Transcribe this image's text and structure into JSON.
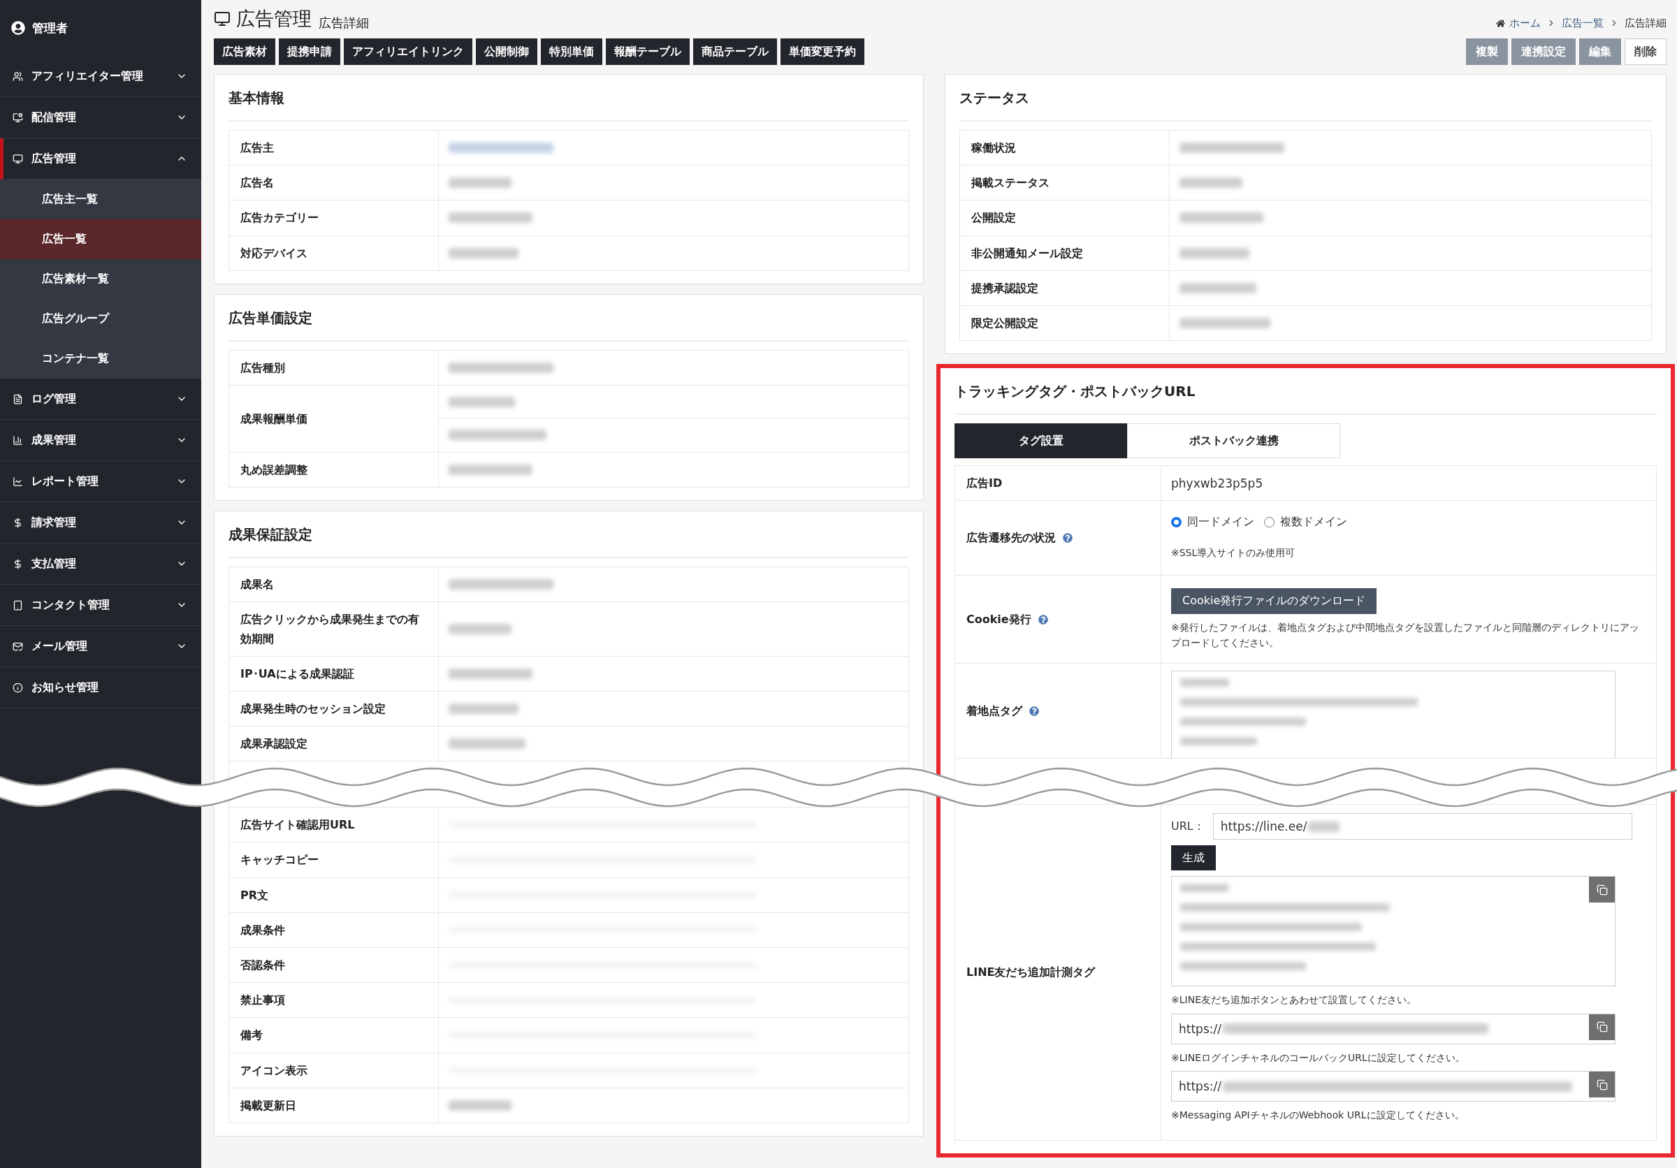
{
  "sidebar": {
    "user": "管理者",
    "items": [
      {
        "label": "アフィリエイター管理",
        "kind": "group",
        "active": false,
        "expanded": false
      },
      {
        "label": "配信管理",
        "kind": "group",
        "active": false,
        "expanded": false
      },
      {
        "label": "広告管理",
        "kind": "group",
        "active": true,
        "expanded": true,
        "children": [
          {
            "label": "広告主一覧",
            "selected": false
          },
          {
            "label": "広告一覧",
            "selected": true
          },
          {
            "label": "広告素材一覧",
            "selected": false
          },
          {
            "label": "広告グループ",
            "selected": false
          },
          {
            "label": "コンテナ一覧",
            "selected": false
          }
        ]
      },
      {
        "label": "ログ管理",
        "kind": "group",
        "active": false,
        "expanded": false
      },
      {
        "label": "成果管理",
        "kind": "group",
        "active": false,
        "expanded": false
      },
      {
        "label": "レポート管理",
        "kind": "group",
        "active": false,
        "expanded": false
      },
      {
        "label": "請求管理",
        "kind": "group",
        "active": false,
        "expanded": false
      },
      {
        "label": "支払管理",
        "kind": "group",
        "active": false,
        "expanded": false
      },
      {
        "label": "コンタクト管理",
        "kind": "group",
        "active": false,
        "expanded": false
      },
      {
        "label": "メール管理",
        "kind": "group",
        "active": false,
        "expanded": false
      },
      {
        "label": "お知らせ管理",
        "kind": "link",
        "active": false
      }
    ]
  },
  "header": {
    "title": "広告管理",
    "subtitle": "広告詳細",
    "breadcrumb": [
      "ホーム",
      "広告一覧",
      "広告詳細"
    ]
  },
  "nav_buttons": [
    "広告素材",
    "提携申請",
    "アフィリエイトリンク",
    "公開制御",
    "特別単価",
    "報酬テーブル",
    "商品テーブル",
    "単価変更予約"
  ],
  "actions": [
    {
      "label": "複製",
      "kind": "secondary"
    },
    {
      "label": "連携設定",
      "kind": "secondary"
    },
    {
      "label": "編集",
      "kind": "secondary"
    },
    {
      "label": "削除",
      "kind": "outline"
    }
  ],
  "left_panels": [
    {
      "title": "基本情報",
      "rows": [
        {
          "label": "広告主",
          "kind": "blurred"
        },
        {
          "label": "広告名",
          "kind": "blurred"
        },
        {
          "label": "広告カテゴリー",
          "kind": "blurred"
        },
        {
          "label": "対応デバイス",
          "kind": "blurred"
        }
      ]
    },
    {
      "title": "広告単価設定",
      "rows": [
        {
          "label": "広告種別",
          "kind": "blurred"
        },
        {
          "label": "成果報酬単価",
          "kind": "double"
        },
        {
          "label": "丸め誤差調整",
          "kind": "blurred"
        }
      ]
    },
    {
      "title": "成果保証設定",
      "rows": [
        {
          "label": "成果名",
          "kind": "blurred"
        },
        {
          "label": "広告クリックから成果発生までの有効期間",
          "kind": "blurred"
        },
        {
          "label": "IP･UAによる成果認証",
          "kind": "blurred"
        },
        {
          "label": "成果発生時のセッション設定",
          "kind": "blurred"
        },
        {
          "label": "成果承認設定",
          "kind": "blurred",
          "break_after": true
        },
        {
          "label": "広告サイト確認用URL",
          "kind": "empty"
        },
        {
          "label": "キャッチコピー",
          "kind": "empty"
        },
        {
          "label": "PR文",
          "kind": "empty"
        },
        {
          "label": "成果条件",
          "kind": "empty"
        },
        {
          "label": "否認条件",
          "kind": "empty"
        },
        {
          "label": "禁止事項",
          "kind": "empty"
        },
        {
          "label": "備考",
          "kind": "empty"
        },
        {
          "label": "アイコン表示",
          "kind": "empty"
        },
        {
          "label": "掲載更新日",
          "kind": "blurred"
        }
      ]
    }
  ],
  "status_panel": {
    "title": "ステータス",
    "rows": [
      {
        "label": "稼働状況",
        "kind": "blurred"
      },
      {
        "label": "掲載ステータス",
        "kind": "blurred"
      },
      {
        "label": "公開設定",
        "kind": "blurred"
      },
      {
        "label": "非公開通知メール設定",
        "kind": "blurred"
      },
      {
        "label": "提携承認設定",
        "kind": "blurred"
      },
      {
        "label": "限定公開設定",
        "kind": "blurred"
      }
    ]
  },
  "tracking_panel": {
    "title": "トラッキングタグ・ポストバックURL",
    "highlighted": true,
    "tabs": [
      {
        "label": "タグ設置",
        "selected": true
      },
      {
        "label": "ポストバック連携",
        "selected": false
      }
    ],
    "rows": [
      {
        "kind": "text",
        "label": "広告ID",
        "help": false,
        "value": "phyxwb23p5p5"
      },
      {
        "kind": "radio",
        "label": "広告遷移先の状況",
        "help": true,
        "options": [
          {
            "label": "同一ドメイン",
            "selected": true
          },
          {
            "label": "複数ドメイン",
            "selected": false
          }
        ],
        "note": "※SSL導入サイトのみ使用可"
      },
      {
        "kind": "download",
        "label": "Cookie発行",
        "help": true,
        "button": "Cookie発行ファイルのダウンロード",
        "note": "※発行したファイルは、着地点タグおよび中間地点タグを設置したファイルと同階層のディレクトリにアップロードしてください。"
      },
      {
        "kind": "code",
        "label": "着地点タグ",
        "help": true,
        "break_after": true
      },
      {
        "kind": "line",
        "label": "LINE友だち追加計測タグ",
        "help": false,
        "url_label": "URL：",
        "url_value": "https://line.ee/",
        "generate": "生成",
        "outputs": [
          {
            "kind": "code",
            "note": "※LINE友だち追加ボタンとあわせて設置してください。"
          },
          {
            "kind": "url",
            "value": "https://",
            "note": "※LINEログインチャネルのコールバックURLに設定してください。"
          },
          {
            "kind": "url",
            "value": "https://",
            "note": "※Messaging APIチャネルのWebhook URLに設定してください。"
          }
        ]
      }
    ]
  }
}
